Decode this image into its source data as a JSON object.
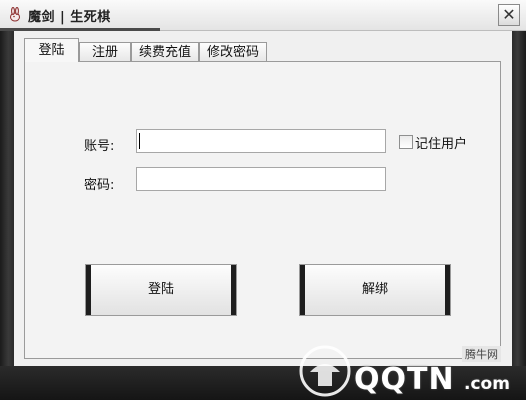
{
  "window": {
    "title": "魔剑 | 生死棋",
    "close_symbol": "✕"
  },
  "tabs": [
    {
      "label": "登陆",
      "active": true
    },
    {
      "label": "注册",
      "active": false
    },
    {
      "label": "续费充值",
      "active": false
    },
    {
      "label": "修改密码",
      "active": false
    }
  ],
  "login_form": {
    "account_label": "账号:",
    "account_value": "",
    "password_label": "密码:",
    "password_value": "",
    "remember_label": "记住用户",
    "remember_checked": false
  },
  "buttons": {
    "login_label": "登陆",
    "unbind_label": "解绑"
  },
  "watermark": {
    "site_label": "腾牛网",
    "brand_text": "QQTN",
    "domain_suffix": ".com"
  },
  "colors": {
    "accent": "#2b9be8",
    "frame": "#1e1e1e"
  },
  "icons": {
    "app": "rabbit-logo-icon",
    "close": "close-icon",
    "checkbox": "checkbox-icon"
  }
}
